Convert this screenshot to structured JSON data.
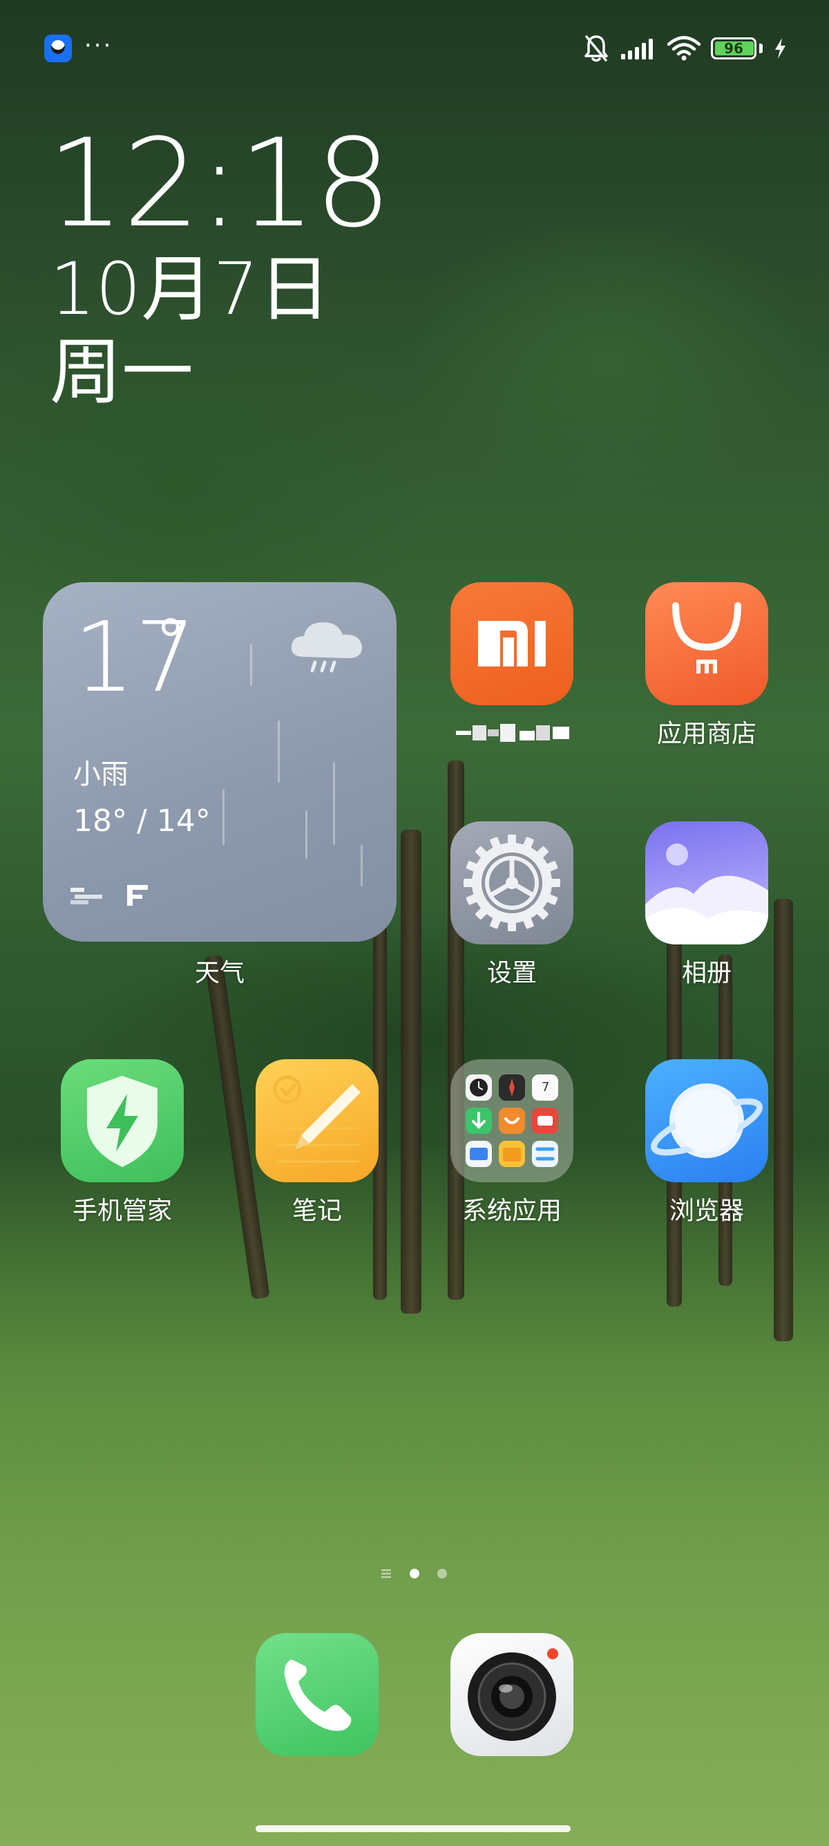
{
  "status_bar": {
    "battery_level": "96",
    "icons": [
      "app-notification-icon",
      "more-dots-icon",
      "bell-muted-icon",
      "cellular-signal-icon",
      "wifi-icon",
      "battery-icon",
      "charging-bolt-icon"
    ],
    "more_dots": "···"
  },
  "clock": {
    "time": "12:18",
    "date": "10月7日",
    "weekday": "周一"
  },
  "weather_widget": {
    "temperature": "17",
    "condition": "小雨",
    "range": "18° / 14°",
    "label": "天气"
  },
  "apps": {
    "mi": {
      "label": ""
    },
    "app_store": {
      "label": "应用商店"
    },
    "settings": {
      "label": "设置"
    },
    "gallery": {
      "label": "相册"
    },
    "security": {
      "label": "手机管家"
    },
    "notes": {
      "label": "笔记"
    },
    "system_apps": {
      "label": "系统应用"
    },
    "browser": {
      "label": "浏览器"
    }
  },
  "dock": {
    "apps": [
      "phone-icon",
      "camera-icon"
    ]
  },
  "colors": {
    "mi_orange": "#f26b25",
    "weather_bg": "#8c98ab",
    "battery_green": "#5fd35b"
  }
}
